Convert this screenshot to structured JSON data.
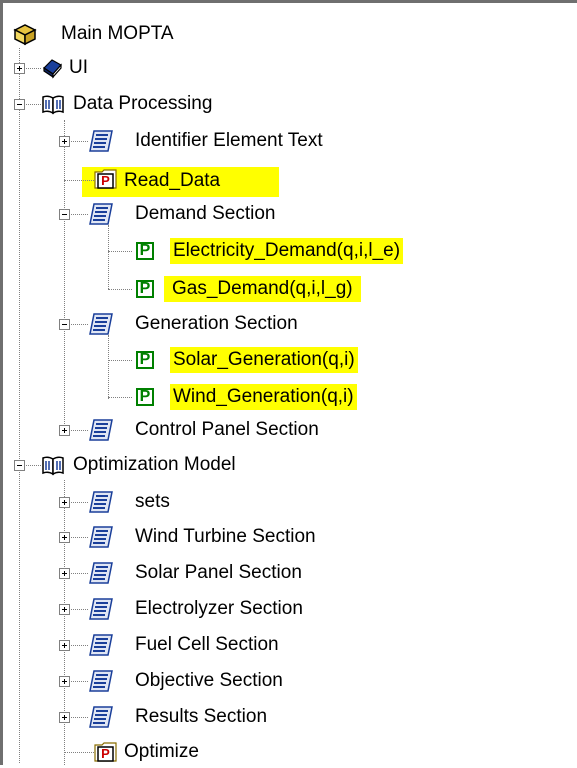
{
  "tree": {
    "root": {
      "label": "Main MOPTA",
      "icon": "main-model-icon"
    },
    "ui": {
      "label": "UI",
      "icon": "book-closed-icon"
    },
    "data_processing": {
      "label": "Data Processing",
      "icon": "book-open-icon",
      "children": {
        "identifier": {
          "label": "Identifier Element Text",
          "icon": "section-icon"
        },
        "read_data": {
          "label": "Read_Data",
          "icon": "procedure-icon"
        },
        "demand": {
          "label": "Demand Section",
          "icon": "section-icon",
          "children": {
            "electricity": {
              "label": "Electricity_Demand(q,i,l_e)",
              "icon": "parameter-icon"
            },
            "gas": {
              "label": "Gas_Demand(q,i,l_g)",
              "icon": "parameter-icon"
            }
          }
        },
        "generation": {
          "label": "Generation Section",
          "icon": "section-icon",
          "children": {
            "solar": {
              "label": "Solar_Generation(q,i)",
              "icon": "parameter-icon"
            },
            "wind": {
              "label": "Wind_Generation(q,i)",
              "icon": "parameter-icon"
            }
          }
        },
        "control_panel": {
          "label": "Control Panel Section",
          "icon": "section-icon"
        }
      }
    },
    "optimization": {
      "label": "Optimization Model",
      "icon": "book-open-icon",
      "children": {
        "sets": {
          "label": "sets"
        },
        "wind_turbine": {
          "label": "Wind Turbine Section"
        },
        "solar_panel": {
          "label": "Solar Panel Section"
        },
        "electrolyzer": {
          "label": "Electrolyzer Section"
        },
        "fuel_cell": {
          "label": "Fuel Cell Section"
        },
        "objective": {
          "label": "Objective Section"
        },
        "results": {
          "label": "Results Section"
        },
        "optimize": {
          "label": "Optimize",
          "icon": "procedure-icon"
        }
      }
    }
  },
  "icon_glyphs": {
    "parameter": "P",
    "procedure": "P"
  },
  "colors": {
    "highlight": "#ffff00",
    "parameter": "#008000",
    "procedure": "#cc0000",
    "section_blue": "#1a3f9a"
  }
}
